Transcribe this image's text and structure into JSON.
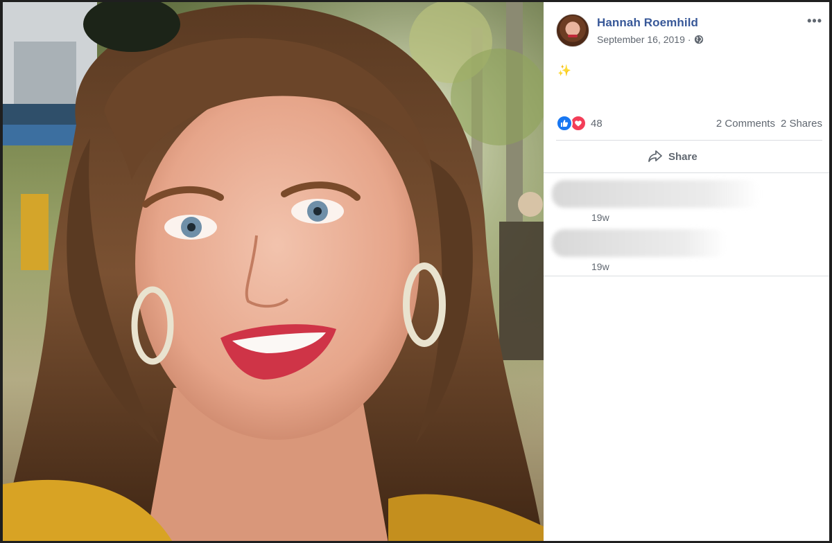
{
  "post": {
    "author": "Hannah Roemhild",
    "date": "September 16, 2019",
    "date_separator": "·",
    "privacy_icon": "globe-icon",
    "more_label": "•••",
    "text": "✨"
  },
  "reactions": {
    "types": [
      "like",
      "love"
    ],
    "count": "48",
    "comments_label": "2 Comments",
    "shares_label": "2 Shares"
  },
  "actions": {
    "share_label": "Share",
    "share_icon": "share-arrow-icon"
  },
  "comments": [
    {
      "time": "19w"
    },
    {
      "time": "19w"
    }
  ],
  "colors": {
    "link": "#385898",
    "secondary_text": "#606770",
    "like_blue": "#1877f2",
    "love_red": "#f33e58",
    "divider": "#dadde1"
  }
}
